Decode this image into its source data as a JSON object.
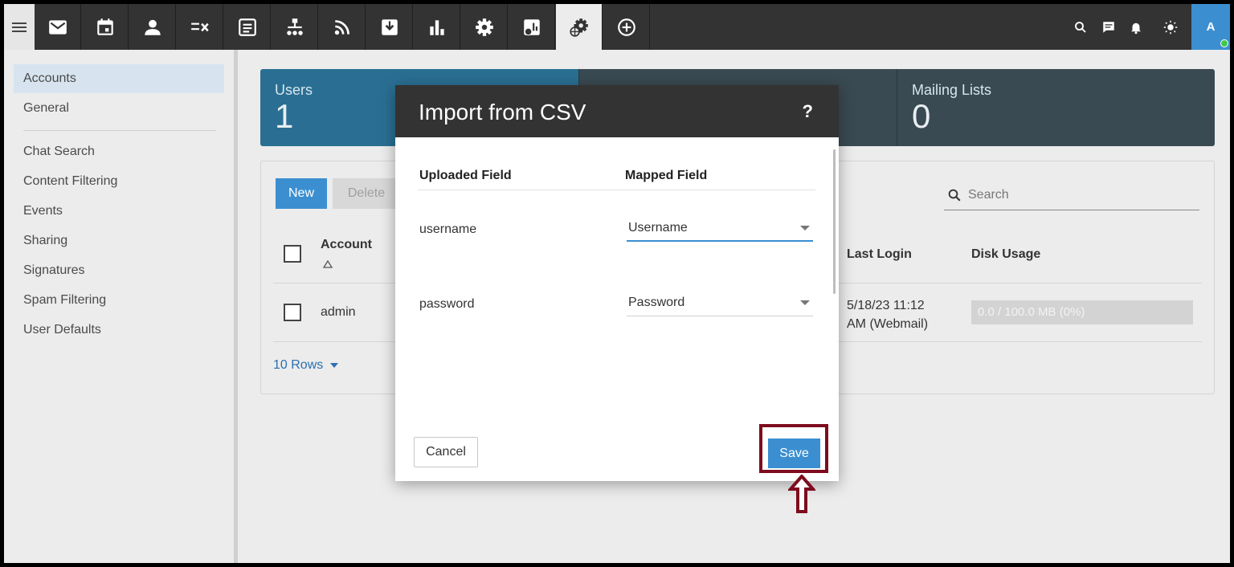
{
  "topbar": {
    "items": [
      {
        "name": "mail-icon"
      },
      {
        "name": "calendar-icon"
      },
      {
        "name": "contacts-icon"
      },
      {
        "name": "tasks-icon"
      },
      {
        "name": "notes-icon"
      },
      {
        "name": "sitemap-icon"
      },
      {
        "name": "rss-icon"
      },
      {
        "name": "inbox-download-icon"
      },
      {
        "name": "reports-icon"
      },
      {
        "name": "settings-gear-icon"
      },
      {
        "name": "domain-reports-icon"
      },
      {
        "name": "domain-settings-icon"
      },
      {
        "name": "add-circle-icon"
      }
    ],
    "avatar_letter": "A"
  },
  "sidebar": {
    "items": [
      {
        "label": "Accounts"
      },
      {
        "label": "General"
      },
      {
        "label": "Chat Search"
      },
      {
        "label": "Content Filtering"
      },
      {
        "label": "Events"
      },
      {
        "label": "Sharing"
      },
      {
        "label": "Signatures"
      },
      {
        "label": "Spam Filtering"
      },
      {
        "label": "User Defaults"
      }
    ]
  },
  "stats": {
    "users_label": "Users",
    "users_value": "1",
    "mailing_label": "Mailing Lists",
    "mailing_value": "0"
  },
  "grid": {
    "new_label": "New",
    "delete_label": "Delete",
    "search_placeholder": "Search",
    "columns": {
      "account": "Account",
      "last_login": "Last Login",
      "disk_usage": "Disk Usage"
    },
    "row": {
      "account": "admin",
      "last_login_line1": "5/18/23 11:12",
      "last_login_line2": "AM (Webmail)",
      "disk_usage": "0.0 / 100.0 MB (0%)"
    },
    "rows_label": "10 Rows"
  },
  "modal": {
    "title": "Import from CSV",
    "help": "?",
    "col_uploaded": "Uploaded Field",
    "col_mapped": "Mapped Field",
    "rows": [
      {
        "uploaded": "username",
        "mapped": "Username"
      },
      {
        "uploaded": "password",
        "mapped": "Password"
      }
    ],
    "cancel_label": "Cancel",
    "save_label": "Save"
  },
  "colors": {
    "topbar": "#333333",
    "accent": "#3b8fd1",
    "users_card": "#2a6f93",
    "stat_card": "#3a4a52",
    "highlight": "#7d0c1e"
  }
}
